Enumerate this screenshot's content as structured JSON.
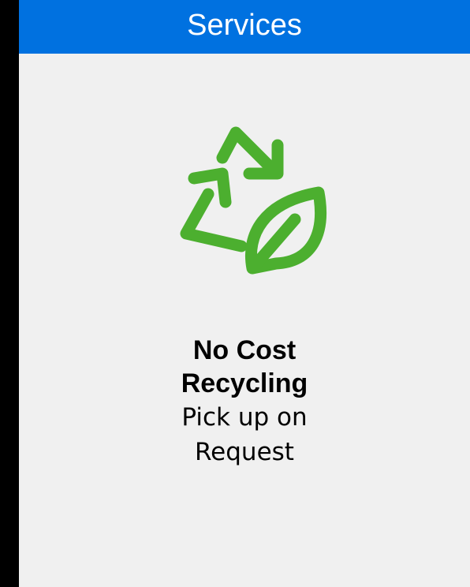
{
  "header": {
    "title": "Services"
  },
  "card": {
    "icon": "recycle-leaf-icon",
    "title_line1": "No Cost",
    "title_line2": "Recycling",
    "subtitle_line1": "Pick up on",
    "subtitle_line2": "Request"
  },
  "colors": {
    "header_bg": "#0071E0",
    "header_text": "#FFFFFF",
    "panel_bg": "#F0F0F0",
    "icon_green": "#4CAF2F",
    "page_bg": "#000000"
  }
}
